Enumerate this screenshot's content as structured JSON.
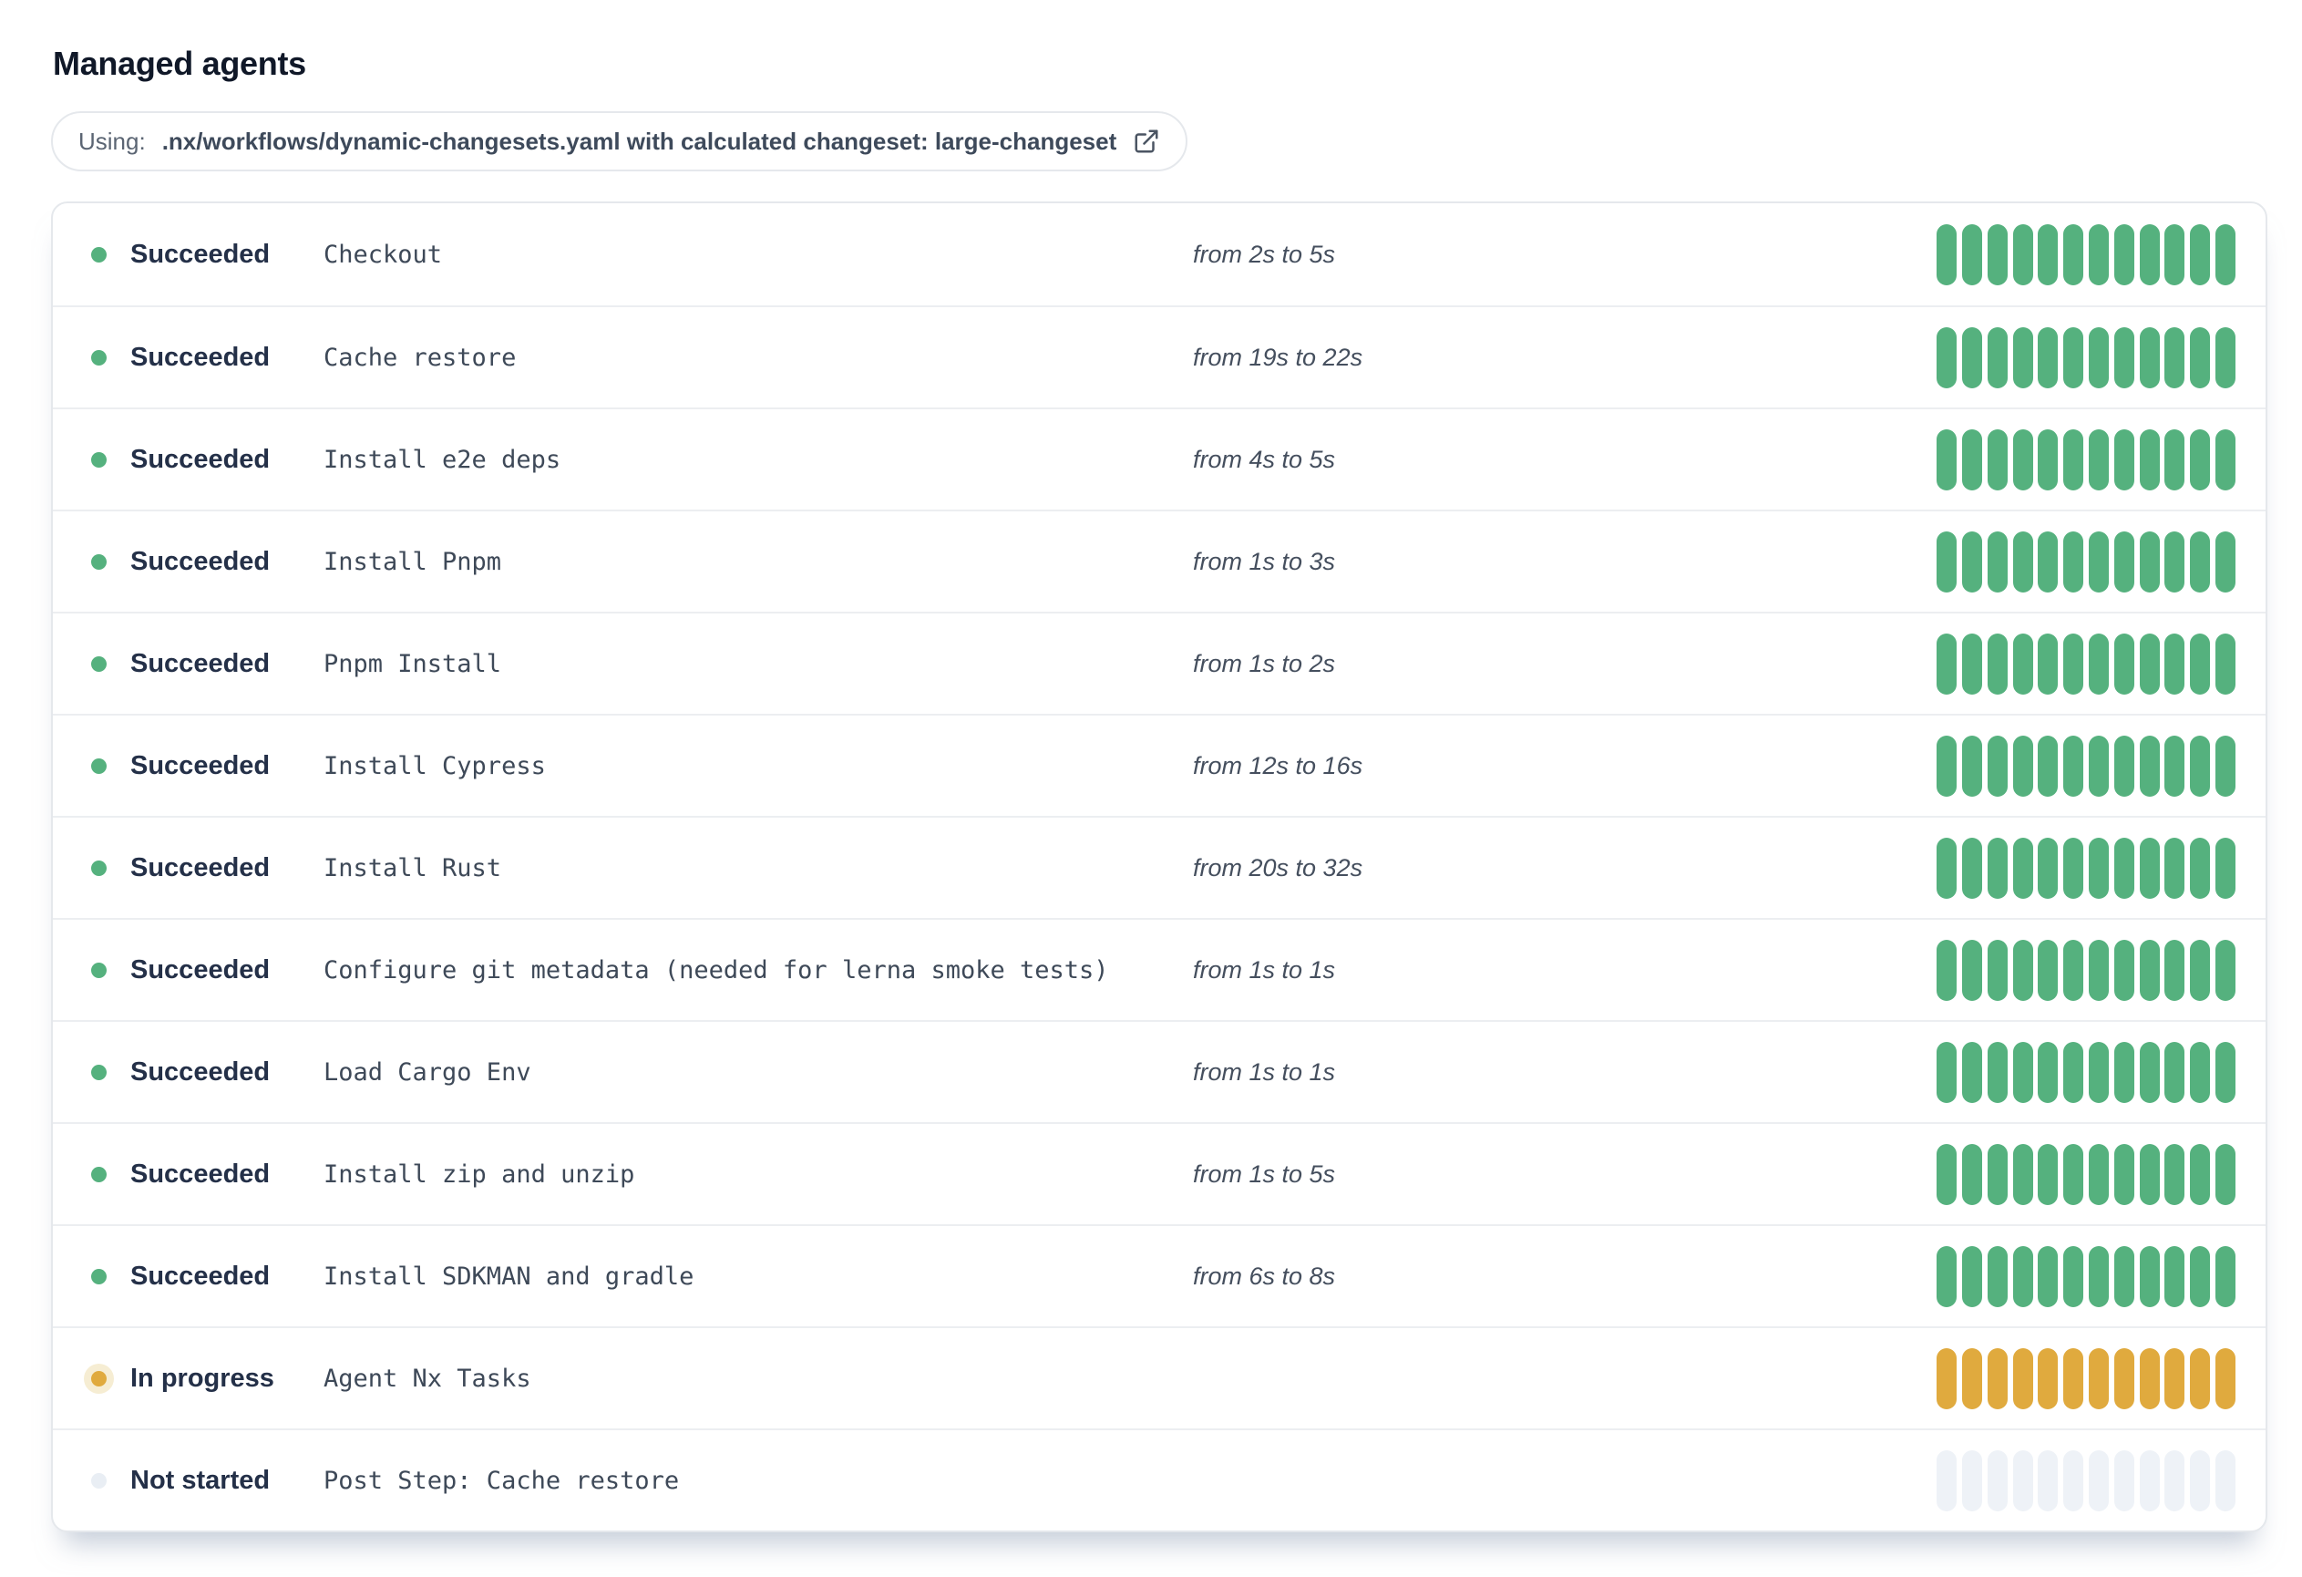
{
  "page": {
    "title": "Managed agents"
  },
  "banner": {
    "prefix_label": "Using:",
    "detail": ".nx/workflows/dynamic-changesets.yaml with calculated changeset: large-changeset",
    "icon": "external-link-icon"
  },
  "colors": {
    "succeeded": "#55b17e",
    "in_progress": "#e0aa3e",
    "in_progress_halo": "#f6edd3",
    "not_started_dot": "#e9eef4",
    "not_started_bar": "#eef2f7",
    "title_text": "#101828",
    "status_text": "#243048",
    "step_text": "#3e4958",
    "duration_text": "#454f5e",
    "border": "#e5e8ec"
  },
  "agents": {
    "segments_per_bar": 12,
    "rows": [
      {
        "status": "Succeeded",
        "state": "succeeded",
        "step": "Checkout",
        "duration": "from 2s to 5s"
      },
      {
        "status": "Succeeded",
        "state": "succeeded",
        "step": "Cache restore",
        "duration": "from 19s to 22s"
      },
      {
        "status": "Succeeded",
        "state": "succeeded",
        "step": "Install e2e deps",
        "duration": "from 4s to 5s"
      },
      {
        "status": "Succeeded",
        "state": "succeeded",
        "step": "Install Pnpm",
        "duration": "from 1s to 3s"
      },
      {
        "status": "Succeeded",
        "state": "succeeded",
        "step": "Pnpm Install",
        "duration": "from 1s to 2s"
      },
      {
        "status": "Succeeded",
        "state": "succeeded",
        "step": "Install Cypress",
        "duration": "from 12s to 16s"
      },
      {
        "status": "Succeeded",
        "state": "succeeded",
        "step": "Install Rust",
        "duration": "from 20s to 32s"
      },
      {
        "status": "Succeeded",
        "state": "succeeded",
        "step": "Configure git metadata (needed for lerna smoke tests)",
        "duration": "from 1s to 1s"
      },
      {
        "status": "Succeeded",
        "state": "succeeded",
        "step": "Load Cargo Env",
        "duration": "from 1s to 1s"
      },
      {
        "status": "Succeeded",
        "state": "succeeded",
        "step": "Install zip and unzip",
        "duration": "from 1s to 5s"
      },
      {
        "status": "Succeeded",
        "state": "succeeded",
        "step": "Install SDKMAN and gradle",
        "duration": "from 6s to 8s"
      },
      {
        "status": "In progress",
        "state": "in-progress",
        "step": "Agent Nx Tasks",
        "duration": ""
      },
      {
        "status": "Not started",
        "state": "not-started",
        "step": "Post Step: Cache restore",
        "duration": ""
      }
    ]
  }
}
